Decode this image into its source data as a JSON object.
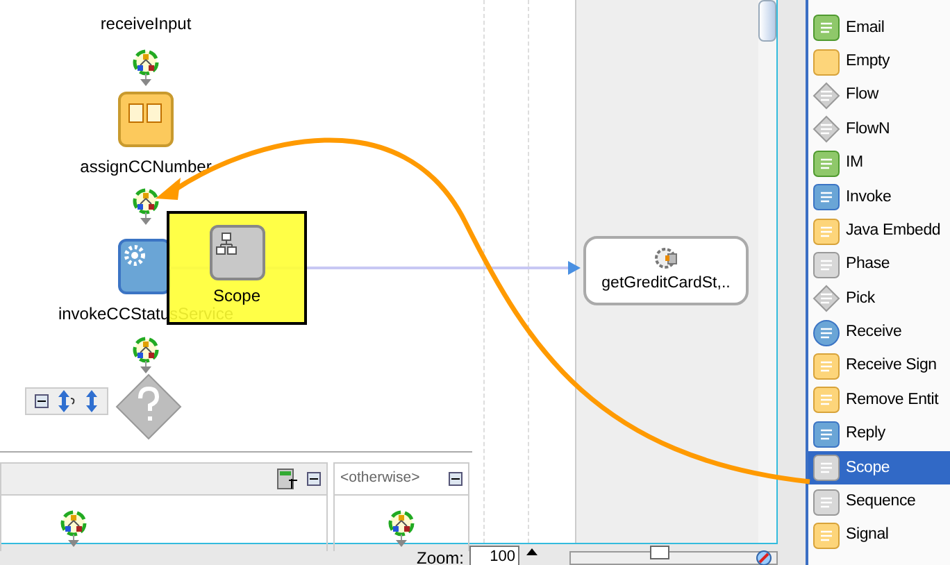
{
  "canvas": {
    "activities": [
      {
        "kind": "receive",
        "label": "receiveInput"
      },
      {
        "kind": "assign",
        "label": "assignCCNumber"
      },
      {
        "kind": "invoke",
        "label": "invokeCCStatusService"
      }
    ],
    "drag_ghost": {
      "label": "Scope"
    },
    "partner_link": {
      "label": "getGreditCardSt,.."
    },
    "switch_cases": [
      {
        "kind": "case"
      },
      {
        "kind": "otherwise",
        "label": "<otherwise>"
      }
    ]
  },
  "palette": {
    "items": [
      {
        "label": "Email",
        "selected": false
      },
      {
        "label": "Empty",
        "selected": false
      },
      {
        "label": "Flow",
        "selected": false
      },
      {
        "label": "FlowN",
        "selected": false
      },
      {
        "label": "IM",
        "selected": false
      },
      {
        "label": "Invoke",
        "selected": false
      },
      {
        "label": "Java Embedd",
        "selected": false
      },
      {
        "label": "Phase",
        "selected": false
      },
      {
        "label": "Pick",
        "selected": false
      },
      {
        "label": "Receive",
        "selected": false
      },
      {
        "label": "Receive Sign",
        "selected": false
      },
      {
        "label": "Remove Entit",
        "selected": false
      },
      {
        "label": "Reply",
        "selected": false
      },
      {
        "label": "Scope",
        "selected": true
      },
      {
        "label": "Sequence",
        "selected": false
      },
      {
        "label": "Signal",
        "selected": false
      }
    ]
  },
  "status_bar": {
    "zoom_label": "Zoom:",
    "zoom_value": "100",
    "zoom_slider": {
      "level": 0.42
    }
  }
}
